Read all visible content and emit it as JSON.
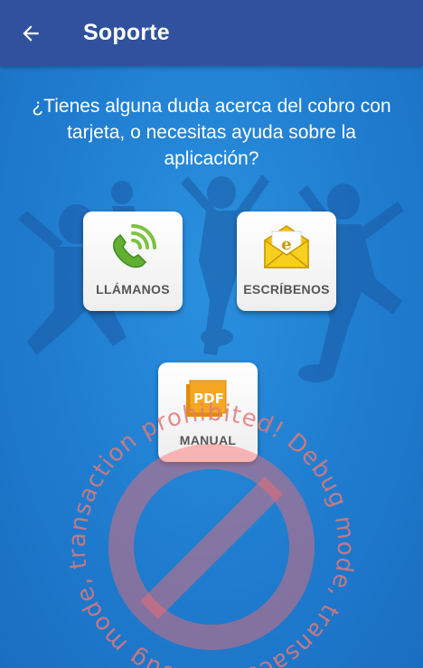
{
  "appbar": {
    "title": "Soporte",
    "back_icon": "arrow-left-icon"
  },
  "main": {
    "question": "¿Tienes alguna duda acerca del cobro con tarjeta, o necesitas ayuda sobre la aplicación?",
    "buttons": [
      {
        "label": "LLÁMANOS",
        "icon": "phone-icon"
      },
      {
        "label": "ESCRÍBENOS",
        "icon": "envelope-icon"
      },
      {
        "label": "MANUAL",
        "icon": "pdf-icon",
        "icon_text": "PDF"
      }
    ]
  },
  "debug_overlay": {
    "text": "Debug mode, transaction prohibited! Debug mode, transaction prohibited!",
    "icon": "prohibited-icon"
  },
  "colors": {
    "appbar": "#30529e",
    "background": "#1f7fd1",
    "phone_green": "#7cc242",
    "envelope_yellow": "#f5c400",
    "pdf_orange": "#f5a623",
    "debug_red": "#e07a7a"
  }
}
